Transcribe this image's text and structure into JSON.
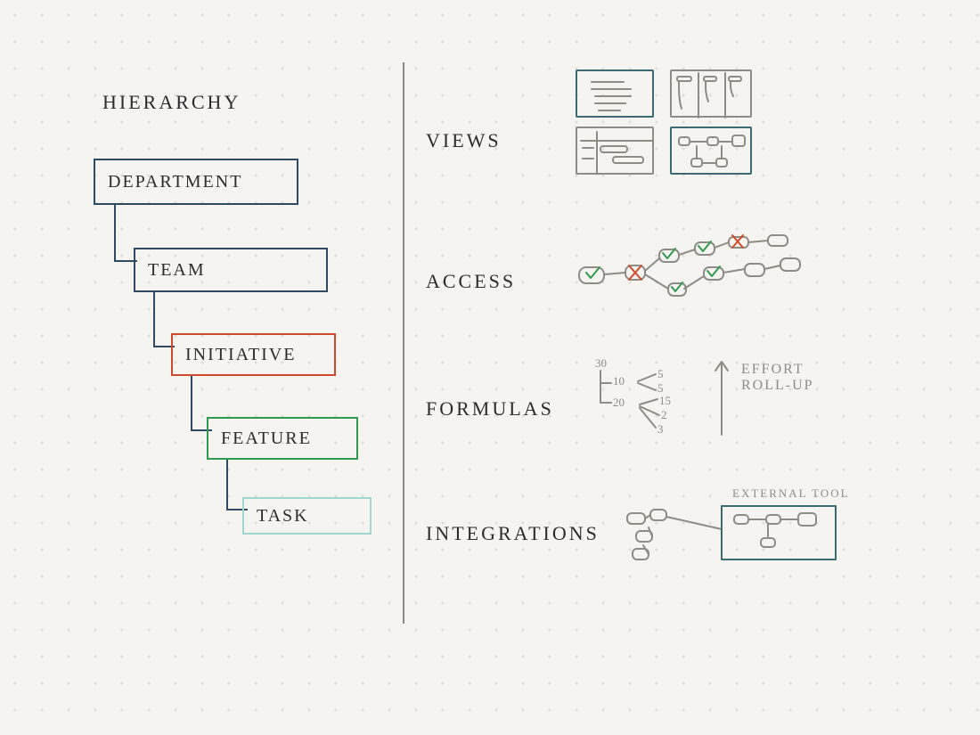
{
  "left": {
    "title": "HIERARCHY",
    "levels": [
      {
        "label": "DEPARTMENT",
        "color": "navy"
      },
      {
        "label": "TEAM",
        "color": "navy"
      },
      {
        "label": "INITIATIVE",
        "color": "orange"
      },
      {
        "label": "FEATURE",
        "color": "green"
      },
      {
        "label": "TASK",
        "color": "teal"
      }
    ]
  },
  "right": {
    "sections": [
      {
        "title": "VIEWS"
      },
      {
        "title": "ACCESS"
      },
      {
        "title": "FORMULAS"
      },
      {
        "title": "INTEGRATIONS"
      }
    ],
    "formulas": {
      "caption": "EFFORT ROLL-UP",
      "root": "30",
      "tree": {
        "10": [
          "5",
          "5"
        ],
        "20": [
          "15",
          "2",
          "3"
        ]
      }
    },
    "integrations": {
      "caption": "EXTERNAL TOOL"
    }
  }
}
